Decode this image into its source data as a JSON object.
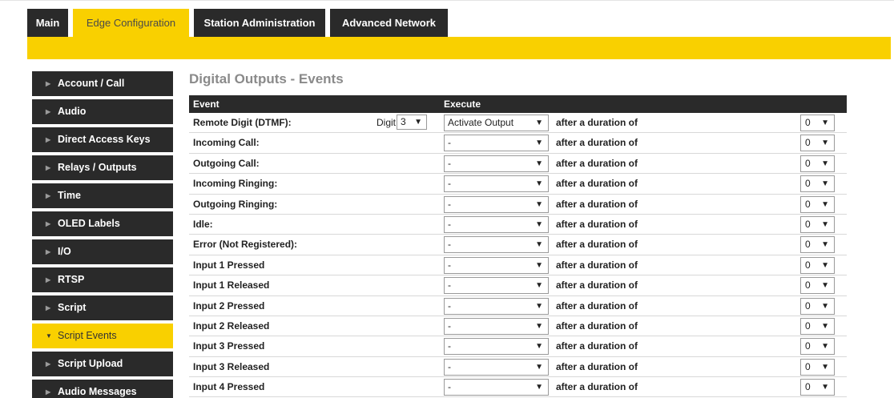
{
  "top_tabs": [
    {
      "label": "Main",
      "active": false
    },
    {
      "label": "Edge Configuration",
      "active": true
    },
    {
      "label": "Station Administration",
      "active": false
    },
    {
      "label": "Advanced Network",
      "active": false
    }
  ],
  "sidebar": {
    "items": [
      {
        "label": "Account / Call",
        "active": false
      },
      {
        "label": "Audio",
        "active": false
      },
      {
        "label": "Direct Access Keys",
        "active": false
      },
      {
        "label": "Relays / Outputs",
        "active": false
      },
      {
        "label": "Time",
        "active": false
      },
      {
        "label": "OLED Labels",
        "active": false
      },
      {
        "label": "I/O",
        "active": false
      },
      {
        "label": "RTSP",
        "active": false
      },
      {
        "label": "Script",
        "active": false
      },
      {
        "label": "Script Events",
        "active": true
      },
      {
        "label": "Script Upload",
        "active": false
      },
      {
        "label": "Audio Messages",
        "active": false
      }
    ]
  },
  "main": {
    "title": "Digital Outputs - Events",
    "columns": {
      "event": "Event",
      "execute": "Execute"
    },
    "digit_label": "Digit",
    "digit_value": "3",
    "caret": "▼",
    "rows": [
      {
        "event": "Remote Digit (DTMF):",
        "action": "Activate Output",
        "after": "after a duration of",
        "duration": "0"
      },
      {
        "event": "Incoming Call:",
        "action": "-",
        "after": "after a duration of",
        "duration": "0"
      },
      {
        "event": "Outgoing Call:",
        "action": "-",
        "after": "after a duration of",
        "duration": "0"
      },
      {
        "event": "Incoming Ringing:",
        "action": "-",
        "after": "after a duration of",
        "duration": "0"
      },
      {
        "event": "Outgoing Ringing:",
        "action": "-",
        "after": "after a duration of",
        "duration": "0"
      },
      {
        "event": "Idle:",
        "action": "-",
        "after": "after a duration of",
        "duration": "0"
      },
      {
        "event": "Error (Not Registered):",
        "action": "-",
        "after": "after a duration of",
        "duration": "0"
      },
      {
        "event": "Input 1 Pressed",
        "action": "-",
        "after": "after a duration of",
        "duration": "0"
      },
      {
        "event": "Input 1 Released",
        "action": "-",
        "after": "after a duration of",
        "duration": "0"
      },
      {
        "event": "Input 2 Pressed",
        "action": "-",
        "after": "after a duration of",
        "duration": "0"
      },
      {
        "event": "Input 2 Released",
        "action": "-",
        "after": "after a duration of",
        "duration": "0"
      },
      {
        "event": "Input 3 Pressed",
        "action": "-",
        "after": "after a duration of",
        "duration": "0"
      },
      {
        "event": "Input 3 Released",
        "action": "-",
        "after": "after a duration of",
        "duration": "0"
      },
      {
        "event": "Input 4 Pressed",
        "action": "-",
        "after": "after a duration of",
        "duration": "0"
      }
    ]
  },
  "colors": {
    "accent": "#f9d000",
    "dark": "#2a2a2a",
    "heading": "#8a8a8a"
  },
  "icons": {
    "sidebar_arrow": "chevron-right-icon",
    "sidebar_arrow_active": "chevron-down-icon",
    "select_caret": "caret-down-icon"
  }
}
